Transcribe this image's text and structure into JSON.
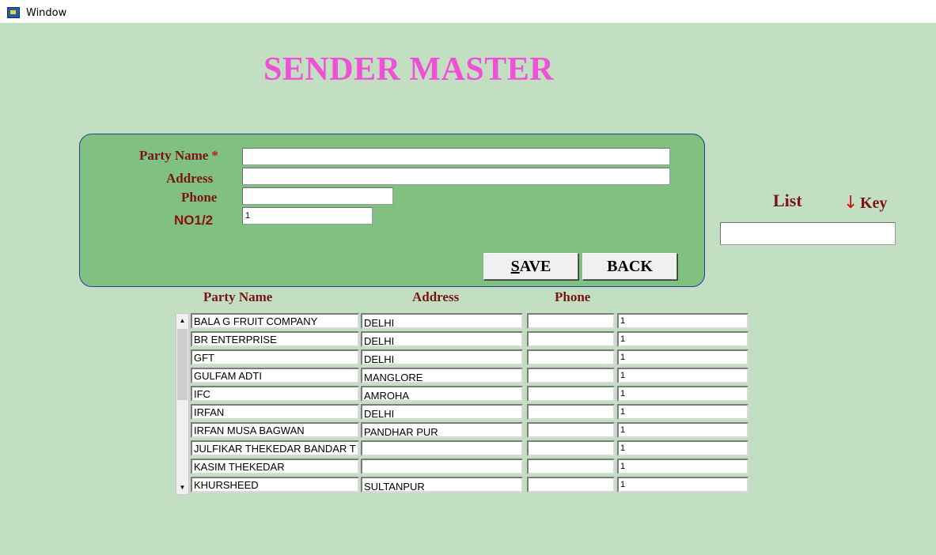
{
  "window": {
    "title": "Window",
    "icon": "app-window-icon"
  },
  "page": {
    "title": "SENDER MASTER"
  },
  "form": {
    "party_name_label": "Party Name",
    "required_mark": "*",
    "party_name_value": "",
    "address_label": "Address",
    "address_value": "",
    "phone_label": "Phone",
    "phone_value": "",
    "no_label": "NO1/2",
    "no_value": "1",
    "save_label": "SAVE",
    "save_accel": "S",
    "save_rest": "AVE",
    "back_label": "BACK"
  },
  "list": {
    "label": "List",
    "key_arrow": "↓",
    "key_label": "Key",
    "search_value": ""
  },
  "table": {
    "headers": {
      "party_name": "Party Name",
      "address": "Address",
      "phone": "Phone"
    },
    "rows": [
      {
        "party_name": "BALA G FRUIT COMPANY",
        "address": "DELHI",
        "phone": "",
        "no": "1"
      },
      {
        "party_name": "BR ENTERPRISE",
        "address": "DELHI",
        "phone": "",
        "no": "1"
      },
      {
        "party_name": "GFT",
        "address": "DELHI",
        "phone": "",
        "no": "1"
      },
      {
        "party_name": "GULFAM ADTI",
        "address": "MANGLORE",
        "phone": "",
        "no": "1"
      },
      {
        "party_name": "IFC",
        "address": "AMROHA",
        "phone": "",
        "no": "1"
      },
      {
        "party_name": "IRFAN",
        "address": "DELHI",
        "phone": "",
        "no": "1"
      },
      {
        "party_name": "IRFAN MUSA BAGWAN",
        "address": "PANDHAR PUR",
        "phone": "",
        "no": "1"
      },
      {
        "party_name": "JULFIKAR THEKEDAR BANDAR T",
        "address": "",
        "phone": "",
        "no": "1"
      },
      {
        "party_name": "KASIM THEKEDAR",
        "address": "",
        "phone": "",
        "no": "1"
      },
      {
        "party_name": "KHURSHEED",
        "address": "SULTANPUR",
        "phone": "",
        "no": "1"
      }
    ]
  },
  "scrollbar": {
    "up_arrow": "▲",
    "down_arrow": "▼"
  }
}
